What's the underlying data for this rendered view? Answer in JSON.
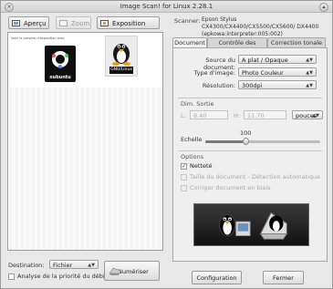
{
  "window": {
    "title": "Image Scan! for Linux 2.28.1"
  },
  "toolbar": {
    "preview_label": "Aperçu",
    "zoom_label": "Zoom",
    "autoexposure_label": "Exposition auto"
  },
  "scanner": {
    "label": "Scanner:",
    "name": "Epson Stylus CX4300/CX4400/CX5500/CX5600/ DX4400 (epkowa:interpreter:005:002)"
  },
  "tabs": [
    {
      "label": "Document"
    },
    {
      "label": "Contrôle des images"
    },
    {
      "label": "Correction tonale"
    }
  ],
  "document": {
    "source_label": "Source du document:",
    "source_value": "A plat / Opaque",
    "type_label": "Type d'image:",
    "type_value": "Photo Couleur",
    "resolution_label": "Résolution:",
    "resolution_value": "300dpi"
  },
  "output": {
    "title": "Dim. Sortie",
    "l_label": "L:",
    "l_value": "8.40",
    "h_label": "H:",
    "h_value": "11.70",
    "unit_value": "pouces",
    "scale_label": "Echelle",
    "scale_value": "100",
    "scale_fraction": 0.35
  },
  "options": {
    "title": "Options",
    "sharpness_label": "Netteté",
    "sharpness_checked": "✓",
    "docsize_label": "Taille du document - Détection automatique",
    "deskew_label": "Corriger document en biais"
  },
  "preview": {
    "header_text": "Voici la preview d'exposition auto",
    "logo1_caption": "xubuntu",
    "logo2_caption": "GNU/Linux"
  },
  "bottom": {
    "destination_label": "Destination:",
    "destination_value": "Fichier",
    "priority_label": "Analyse de la priorité du débit",
    "scan_label": "Numériser",
    "config_label": "Configuration",
    "close_label": "Fermer"
  },
  "colors": {
    "window_bg": "#e8e8e8",
    "accent": "#2b2b2b"
  }
}
